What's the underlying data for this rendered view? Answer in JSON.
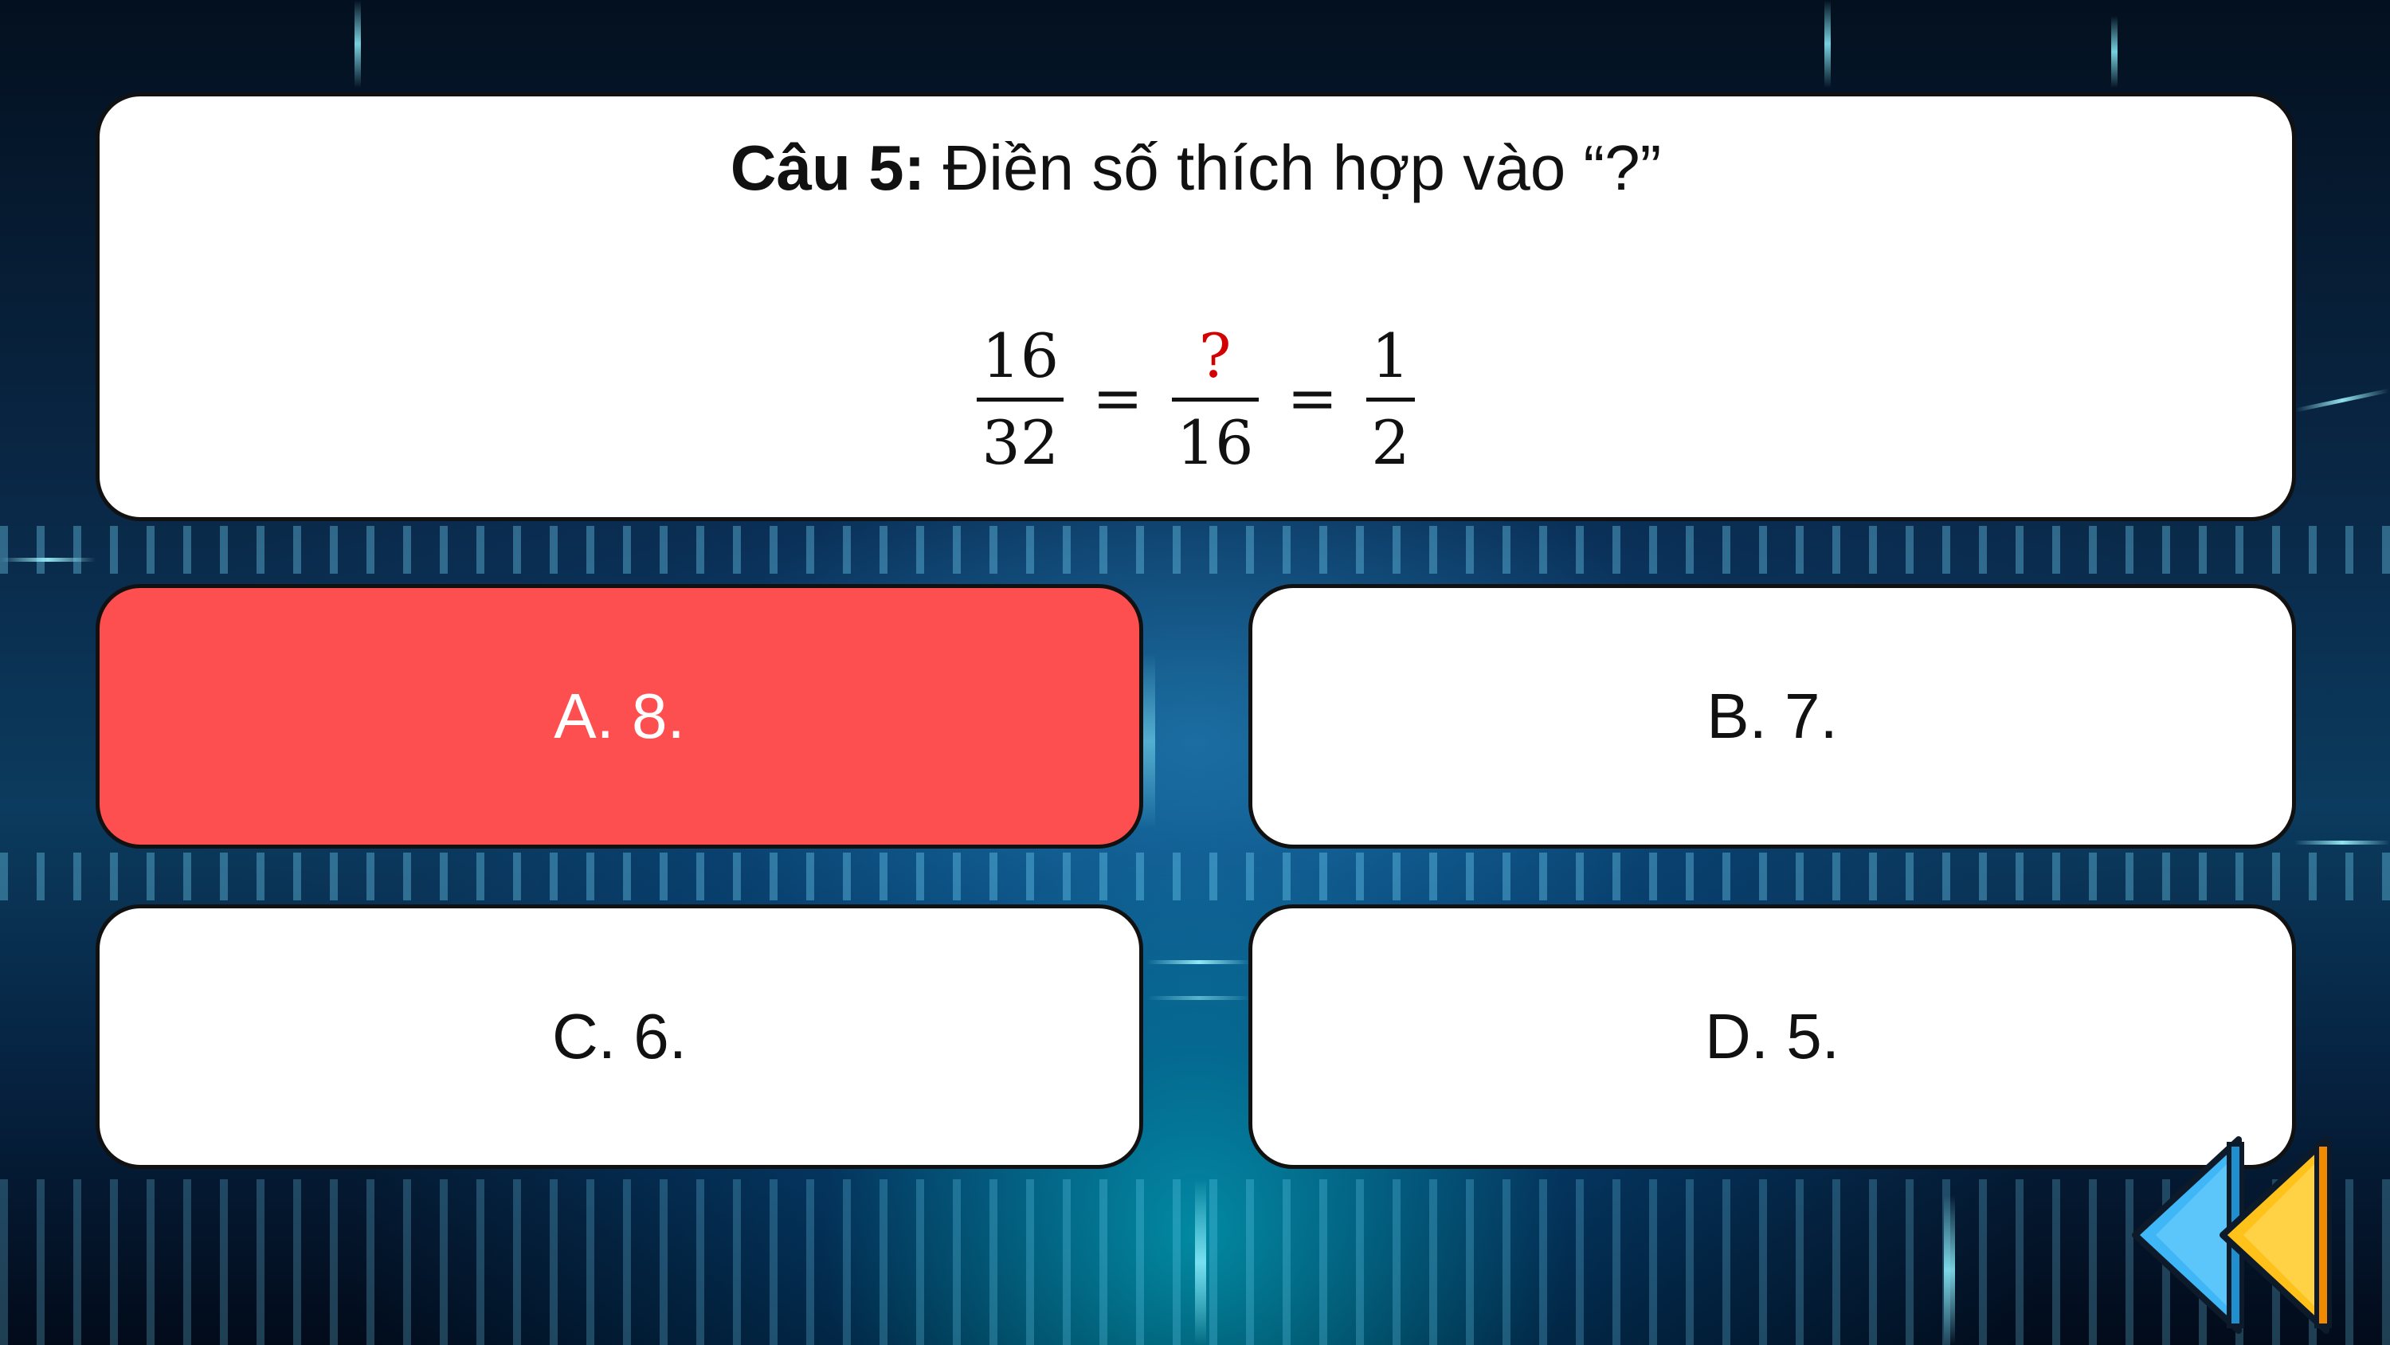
{
  "question": {
    "label": "Câu 5:",
    "text": " Điền số thích hợp vào “?”",
    "equation": {
      "frac1": {
        "numerator": "16",
        "denominator": "32"
      },
      "equals_1": "=",
      "frac2": {
        "numerator": "?",
        "denominator": "16"
      },
      "equals_2": "=",
      "frac3": {
        "numerator": "1",
        "denominator": "2"
      }
    }
  },
  "answers": {
    "a": "A. 8.",
    "b": "B. 7.",
    "c": "C. 6.",
    "d": "D. 5."
  },
  "selected_answer": "a",
  "colors": {
    "selected_answer_bg": "#fd4f4f",
    "unknown_mark": "#d20000",
    "back_arrow_blue": "#3fb6f5",
    "back_arrow_yellow": "#ffc21a"
  },
  "icons": {
    "back": "back-arrow-icon"
  }
}
